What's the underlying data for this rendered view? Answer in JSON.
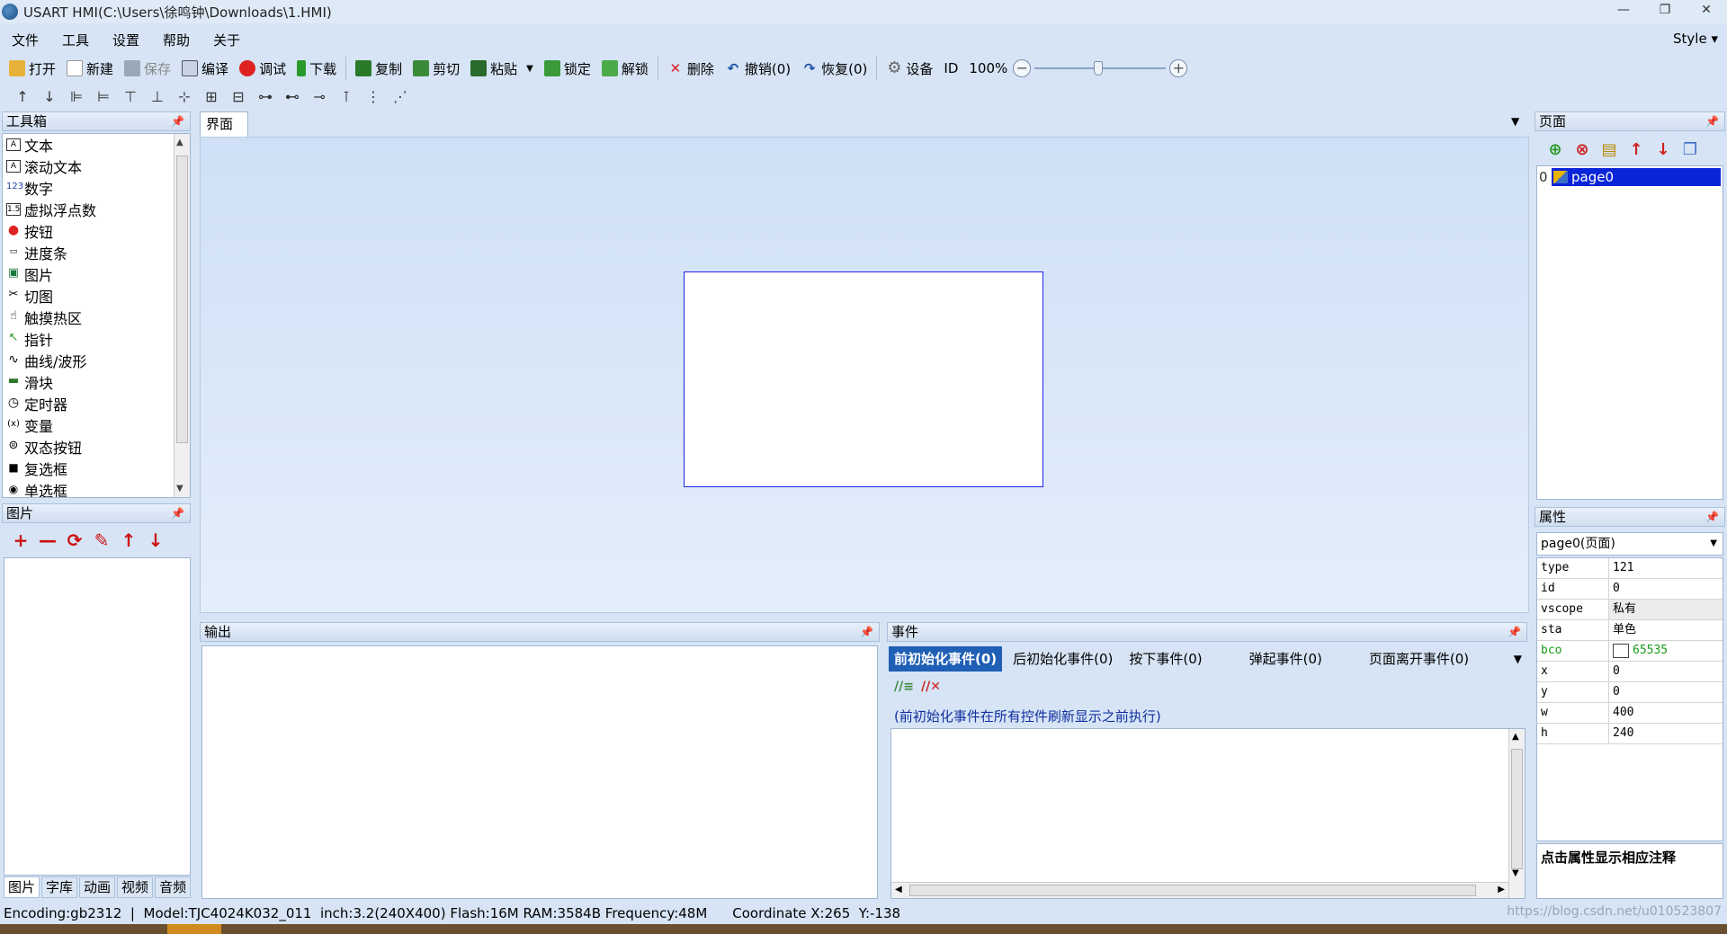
{
  "window": {
    "title": "USART  HMI(C:\\Users\\徐鸣钟\\Downloads\\1.HMI)",
    "controls": [
      "—",
      "❐",
      "✕"
    ]
  },
  "menu": {
    "items": [
      "文件",
      "工具",
      "设置",
      "帮助",
      "关于"
    ],
    "style_label": "Style ▾"
  },
  "toolbar": {
    "open": "打开",
    "new": "新建",
    "save": "保存",
    "compile": "编译",
    "debug": "调试",
    "download": "下载",
    "copy": "复制",
    "cut": "剪切",
    "paste": "粘贴",
    "lock": "锁定",
    "unlock": "解锁",
    "delete": "删除",
    "undo": "撤销(0)",
    "redo": "恢复(0)",
    "device": "设备",
    "id": "ID",
    "zoom": "100%"
  },
  "align_toolbar": {
    "buttons": [
      "↑",
      "↓",
      "⊫",
      "⊨",
      "⊤",
      "⊥",
      "⊹",
      "⊞",
      "⊟",
      "⊶",
      "⊷",
      "⊸",
      "⊺",
      "⋮",
      "⋰"
    ]
  },
  "toolbox": {
    "title": "工具箱",
    "items": [
      {
        "icon": "A",
        "label": "文本"
      },
      {
        "icon": "A",
        "label": "滚动文本"
      },
      {
        "icon": "123",
        "label": "数字"
      },
      {
        "icon": "1.5",
        "label": "虚拟浮点数"
      },
      {
        "icon": "●",
        "label": "按钮"
      },
      {
        "icon": "▭",
        "label": "进度条"
      },
      {
        "icon": "▣",
        "label": "图片"
      },
      {
        "icon": "✂",
        "label": "切图"
      },
      {
        "icon": "☝",
        "label": "触摸热区"
      },
      {
        "icon": "↖",
        "label": "指针"
      },
      {
        "icon": "∿",
        "label": "曲线/波形"
      },
      {
        "icon": "▬",
        "label": "滑块"
      },
      {
        "icon": "◷",
        "label": "定时器"
      },
      {
        "icon": "(x)",
        "label": "变量"
      },
      {
        "icon": "⊜",
        "label": "双态按钮"
      },
      {
        "icon": "■",
        "label": "复选框"
      },
      {
        "icon": "◉",
        "label": "单选框"
      }
    ]
  },
  "images_panel": {
    "title": "图片",
    "tools": [
      "+",
      "—",
      "⟳",
      "✎",
      "↑",
      "↓"
    ],
    "tabs": [
      "图片",
      "字库",
      "动画",
      "视频",
      "音频"
    ]
  },
  "design": {
    "tab": "界面"
  },
  "output": {
    "title": "输出"
  },
  "events": {
    "title": "事件",
    "tabs": [
      "前初始化事件(0)",
      "后初始化事件(0)",
      "按下事件(0)",
      "弹起事件(0)",
      "页面离开事件(0)"
    ],
    "description": "(前初始化事件在所有控件刷新显示之前执行)"
  },
  "pages": {
    "title": "页面",
    "list": [
      {
        "index": "0",
        "name": "page0"
      }
    ]
  },
  "properties": {
    "title": "属性",
    "selected": "page0(页面)",
    "rows": [
      {
        "key": "type",
        "value": "121"
      },
      {
        "key": "id",
        "value": "0"
      },
      {
        "key": "vscope",
        "value": "私有"
      },
      {
        "key": "sta",
        "value": "单色"
      },
      {
        "key": "bco",
        "value": "65535"
      },
      {
        "key": "x",
        "value": "0"
      },
      {
        "key": "y",
        "value": "0"
      },
      {
        "key": "w",
        "value": "400"
      },
      {
        "key": "h",
        "value": "240"
      }
    ],
    "hint": "点击属性显示相应注释"
  },
  "status": {
    "info": "Encoding:gb2312  |  Model:TJC4024K032_011  inch:3.2(240X400) Flash:16M RAM:3584B Frequency:48M",
    "coordinate": "Coordinate X:265  Y:-138",
    "watermark": "https://blog.csdn.net/u010523807"
  },
  "colors": {
    "accent": "#1f5fb5",
    "selection": "#0a24d8",
    "canvas_border": "#2222ee",
    "background": "#d6e4f5"
  }
}
